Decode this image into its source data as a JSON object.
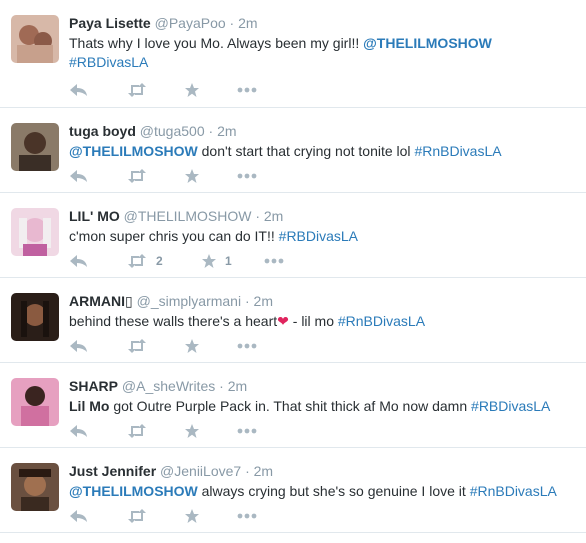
{
  "tweets": [
    {
      "fullname": "Paya Lisette",
      "username": "@PayaPoo",
      "sep": " · ",
      "time": "2m",
      "line1": "Thats why I love you Mo. Always been my girl!! ",
      "mention": "@THELILMOSHOW",
      "hashtag": "#RBDivasLA",
      "avatar_color": "#b08a7a"
    },
    {
      "fullname": "tuga boyd",
      "username": "@tuga500",
      "sep": " · ",
      "time": "2m",
      "mention": "@THELILMOSHOW",
      "text": " don't start that crying not tonite lol ",
      "hashtag": "#RnBDivasLA",
      "avatar_color": "#6b5a4a"
    },
    {
      "fullname": "LIL' MO",
      "username": "@THELILMOSHOW",
      "sep": " · ",
      "time": "2m",
      "text": "c'mon super chris you can do IT!! ",
      "hashtag": "#RBDivasLA",
      "retweets": "2",
      "favorites": "1",
      "avatar_color": "#d9a6c2"
    },
    {
      "fullname": "ARMANI",
      "fullname_suffix": "▯",
      "username": "@_simplyarmani",
      "sep": " · ",
      "time": "2m",
      "text": "behind these walls there's a heart",
      "heart": "❤",
      "text2": " - lil mo ",
      "hashtag": "#RnBDivasLA",
      "avatar_color": "#4a3a30"
    },
    {
      "fullname": "SHARP",
      "username": "@A_sheWrites",
      "sep": " · ",
      "time": "2m",
      "bold": "Lil Mo",
      "text": " got Outre Purple Pack in. That shit thick af Mo now damn ",
      "hashtag": "#RBDivasLA",
      "avatar_color": "#c47aa0"
    },
    {
      "fullname": "Just Jennifer",
      "username": "@JeniiLove7",
      "sep": " · ",
      "time": "2m",
      "mention": "@THELILMOSHOW",
      "text": " always crying but she's so genuine I love it ",
      "hashtag": "#RnBDivasLA",
      "avatar_color": "#5a4030"
    }
  ],
  "icons": [
    "reply-icon",
    "retweet-icon",
    "favorite-icon",
    "more-icon"
  ],
  "colors": {
    "link": "#2b7bb9",
    "muted": "#8899a6",
    "action": "#aab8c2"
  }
}
